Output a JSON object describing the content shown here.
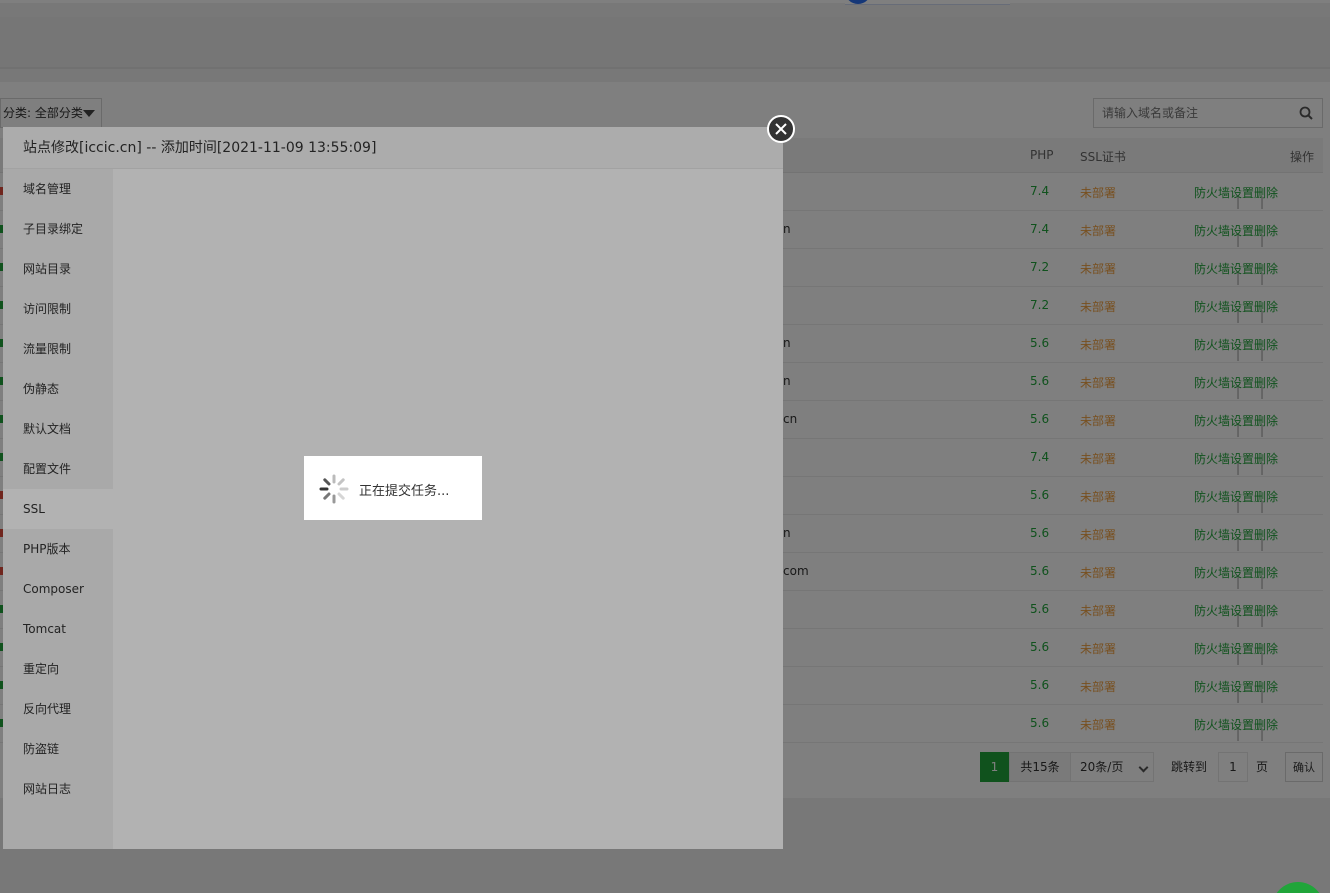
{
  "filter": {
    "category_label": "分类: 全部分类"
  },
  "search": {
    "placeholder": "请输入域名或备注"
  },
  "table": {
    "headers": {
      "php": "PHP",
      "ssl": "SSL证书",
      "actions": "操作"
    },
    "rows": [
      {
        "name": "",
        "php": "7.4",
        "ssl": "未部署",
        "status": "stopped"
      },
      {
        "name": "n",
        "php": "7.4",
        "ssl": "未部署",
        "status": "running"
      },
      {
        "name": "",
        "php": "7.2",
        "ssl": "未部署",
        "status": "running"
      },
      {
        "name": "",
        "php": "7.2",
        "ssl": "未部署",
        "status": "running"
      },
      {
        "name": "n",
        "php": "5.6",
        "ssl": "未部署",
        "status": "running"
      },
      {
        "name": "n",
        "php": "5.6",
        "ssl": "未部署",
        "status": "running"
      },
      {
        "name": "cn",
        "php": "5.6",
        "ssl": "未部署",
        "status": "running"
      },
      {
        "name": "",
        "php": "7.4",
        "ssl": "未部署",
        "status": "running"
      },
      {
        "name": "",
        "php": "5.6",
        "ssl": "未部署",
        "status": "stopped"
      },
      {
        "name": "n",
        "php": "5.6",
        "ssl": "未部署",
        "status": "stopped"
      },
      {
        "name": "com",
        "php": "5.6",
        "ssl": "未部署",
        "status": "stopped"
      },
      {
        "name": "",
        "php": "5.6",
        "ssl": "未部署",
        "status": "running"
      },
      {
        "name": "",
        "php": "5.6",
        "ssl": "未部署",
        "status": "running"
      },
      {
        "name": "",
        "php": "5.6",
        "ssl": "未部署",
        "status": "running"
      },
      {
        "name": "",
        "php": "5.6",
        "ssl": "未部署",
        "status": "running"
      }
    ],
    "ops": {
      "firewall": "防火墙",
      "settings": "设置",
      "delete": "删除",
      "sep": "|"
    }
  },
  "pager": {
    "current": "1",
    "total": "共15条",
    "page_size": "20条/页",
    "jump_label": "跳转到",
    "jump_value": "1",
    "page_unit": "页",
    "confirm": "确认"
  },
  "modal": {
    "title": "站点修改[iccic.cn] -- 添加时间[2021-11-09 13:55:09]",
    "menu": [
      "域名管理",
      "子目录绑定",
      "网站目录",
      "访问限制",
      "流量限制",
      "伪静态",
      "默认文档",
      "配置文件",
      "SSL",
      "PHP版本",
      "Composer",
      "Tomcat",
      "重定向",
      "反向代理",
      "防盗链",
      "网站日志"
    ],
    "active_index": 8
  },
  "loading": {
    "message": "正在提交任务..."
  },
  "colors": {
    "accent": "#20a53a",
    "warning": "#f0a040",
    "stopped": "#e04c3c"
  }
}
